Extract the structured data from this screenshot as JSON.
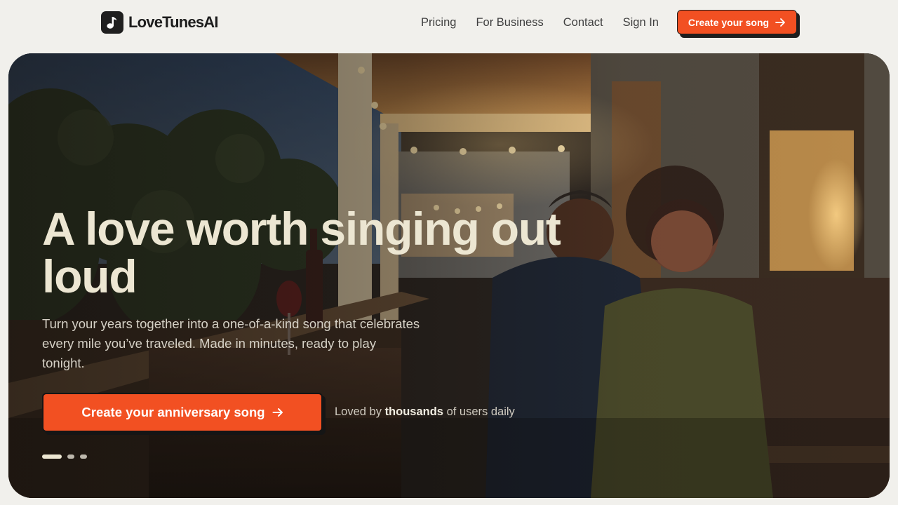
{
  "brand": {
    "name": "LoveTunesAI",
    "logo_icon": "music-note-icon",
    "accent_color": "#f25022",
    "dark_color": "#1e1e1e"
  },
  "nav": {
    "items": [
      {
        "label": "Pricing"
      },
      {
        "label": "For Business"
      },
      {
        "label": "Contact"
      },
      {
        "label": "Sign In"
      }
    ],
    "cta_label": "Create your song",
    "cta_icon": "arrow-right-icon"
  },
  "hero": {
    "title": "A love worth singing out loud",
    "subtitle": "Turn your years together into a one-of-a-kind song that celebrates every mile you’ve traveled. Made in minutes, ready to play tonight.",
    "cta_label": "Create your anniversary song",
    "cta_icon": "arrow-right-icon",
    "social_proof": {
      "prefix": "Loved by ",
      "highlight": "thousands",
      "suffix": " of users daily"
    },
    "carousel": {
      "slide_count": 3,
      "active_slide": 1
    },
    "background_description_icon": "couple-on-porch-photo",
    "title_color": "#ece6d2"
  }
}
